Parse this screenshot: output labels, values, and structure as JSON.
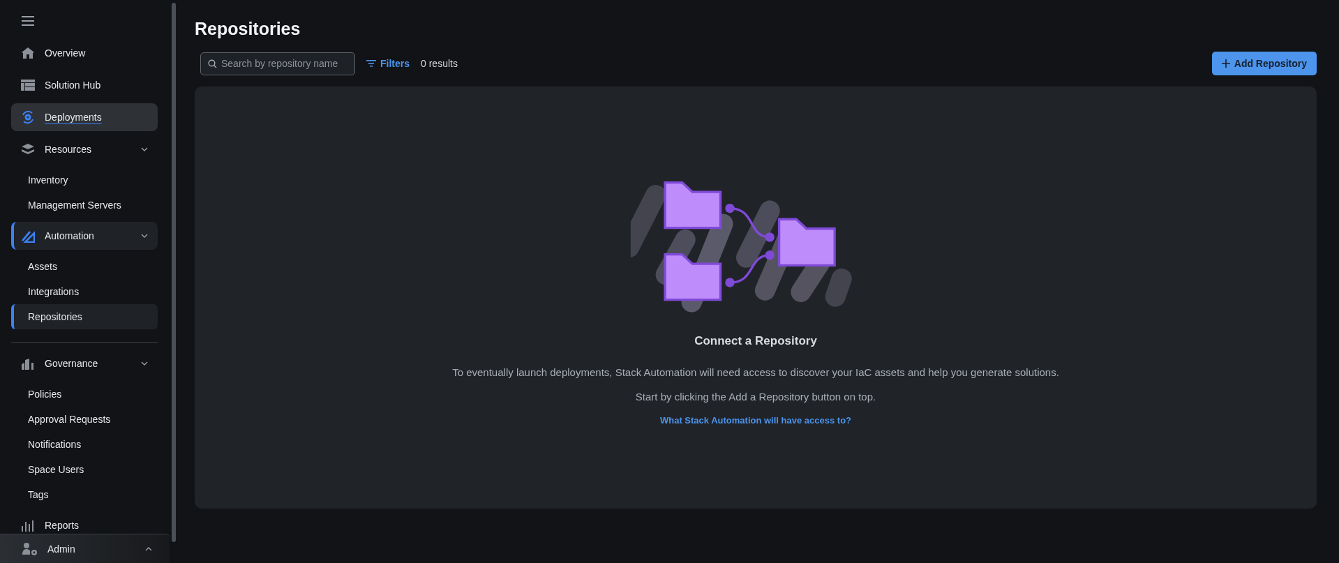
{
  "sidebar": {
    "items": [
      {
        "label": "Overview",
        "selected": false,
        "hovered": false
      },
      {
        "label": "Solution Hub",
        "selected": false,
        "hovered": false
      },
      {
        "label": "Deployments",
        "selected": false,
        "hovered": true
      },
      {
        "label": "Resources",
        "selected": false,
        "hovered": false,
        "expanded": true,
        "children": [
          {
            "label": "Inventory",
            "selected": false
          },
          {
            "label": "Management Servers",
            "selected": false
          }
        ]
      },
      {
        "label": "Automation",
        "selected": true,
        "hovered": false,
        "expanded": true,
        "children": [
          {
            "label": "Assets",
            "selected": false
          },
          {
            "label": "Integrations",
            "selected": false
          },
          {
            "label": "Repositories",
            "selected": true
          }
        ]
      },
      {
        "kind": "divider"
      },
      {
        "label": "Governance",
        "selected": false,
        "hovered": false,
        "expanded": true,
        "children": [
          {
            "label": "Policies",
            "selected": false
          },
          {
            "label": "Approval Requests",
            "selected": false
          },
          {
            "label": "Notifications",
            "selected": false
          },
          {
            "label": "Space Users",
            "selected": false
          },
          {
            "label": "Tags",
            "selected": false
          }
        ]
      },
      {
        "label": "Reports",
        "selected": false,
        "hovered": false
      }
    ],
    "footer": {
      "label": "Admin",
      "expanded": false
    }
  },
  "page": {
    "title": "Repositories",
    "search": {
      "placeholder": "Search by repository name"
    },
    "filters": "Filters",
    "results": "0 results",
    "add_button": "Add Repository"
  },
  "empty_state": {
    "title": "Connect a Repository",
    "lines": [
      "To eventually launch deployments, Stack Automation will need access to discover your IaC assets and help you generate solutions.",
      "Start by clicking the Add a Repository button on top."
    ],
    "link": "What Stack Automation will have access to?"
  }
}
